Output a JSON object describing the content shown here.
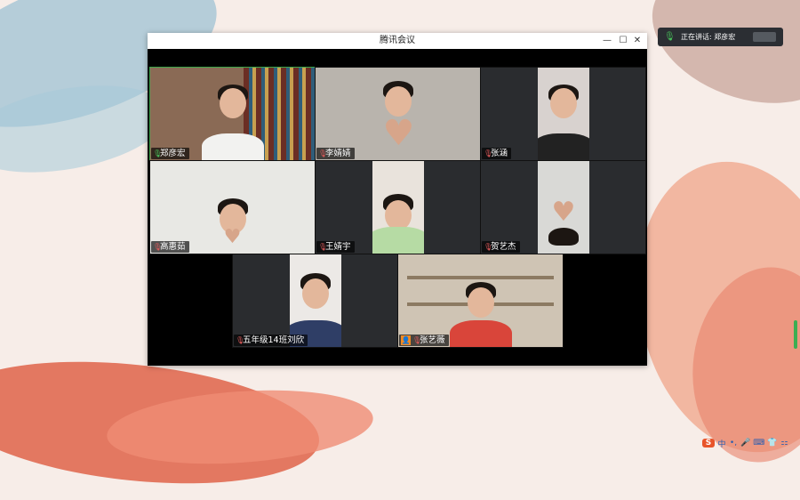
{
  "window": {
    "title": "腾讯会议",
    "minimize": "—",
    "maximize": "☐",
    "close": "✕"
  },
  "notification": {
    "text": "正在讲话: 郑彦宏"
  },
  "participants": [
    {
      "name": "郑彦宏",
      "mic_on": true,
      "active_speaker": true
    },
    {
      "name": "李婧婧",
      "mic_on": false,
      "active_speaker": false
    },
    {
      "name": "张涵",
      "mic_on": false,
      "active_speaker": false
    },
    {
      "name": "高惠茹",
      "mic_on": false,
      "active_speaker": false
    },
    {
      "name": "王婧宇",
      "mic_on": false,
      "active_speaker": false
    },
    {
      "name": "贺艺杰",
      "mic_on": false,
      "active_speaker": false
    },
    {
      "name": "五年级14班刘欣",
      "mic_on": false,
      "active_speaker": false
    },
    {
      "name": "张艺薇",
      "mic_on": false,
      "active_speaker": false,
      "host_badge": true
    }
  ],
  "tray": {
    "ime_logo": "S",
    "lang": "中",
    "punct": "•,",
    "mic": "🎤",
    "keyboard": "⌨",
    "skin": "👕",
    "menu": "⚏"
  },
  "colors": {
    "active_border": "#3ca64a",
    "mic_on": "#48c25a",
    "mic_off": "#e05a5a"
  }
}
